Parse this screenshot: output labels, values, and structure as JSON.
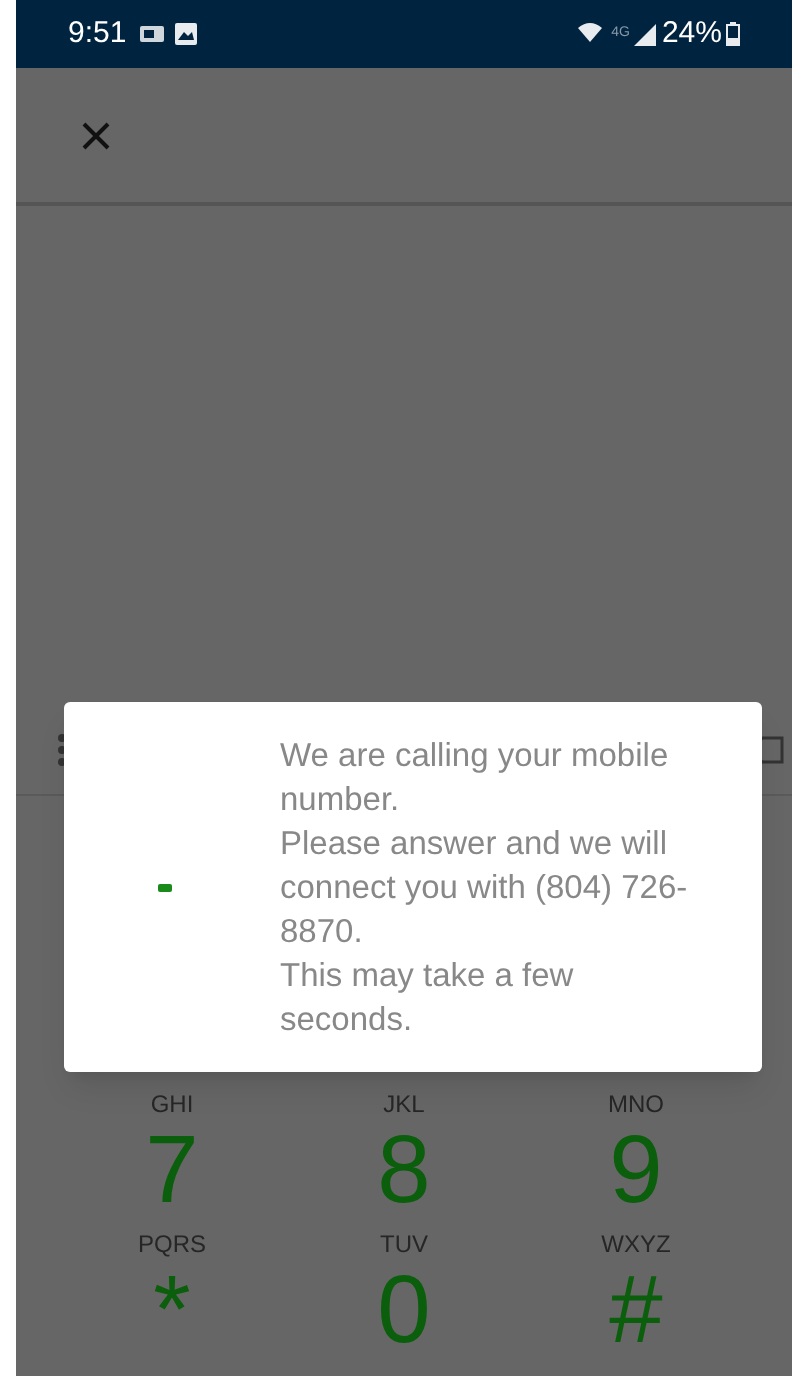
{
  "status_bar": {
    "time": "9:51",
    "battery": "24%",
    "network": "4G"
  },
  "dialog": {
    "lines": [
      "We are calling your mobile number.",
      "Please answer and we will connect you with (804) 726-8870.",
      "This may take a few seconds."
    ]
  },
  "keypad": [
    {
      "kind": "letters",
      "text": "GHI"
    },
    {
      "kind": "letters",
      "text": "JKL"
    },
    {
      "kind": "letters",
      "text": "MNO"
    },
    {
      "kind": "digit",
      "text": "7"
    },
    {
      "kind": "digit",
      "text": "8"
    },
    {
      "kind": "digit",
      "text": "9"
    },
    {
      "kind": "letters",
      "text": "PQRS"
    },
    {
      "kind": "letters",
      "text": "TUV"
    },
    {
      "kind": "letters",
      "text": "WXYZ"
    },
    {
      "kind": "digit",
      "text": "*"
    },
    {
      "kind": "digit",
      "text": "0"
    },
    {
      "kind": "digit",
      "text": "#"
    }
  ]
}
